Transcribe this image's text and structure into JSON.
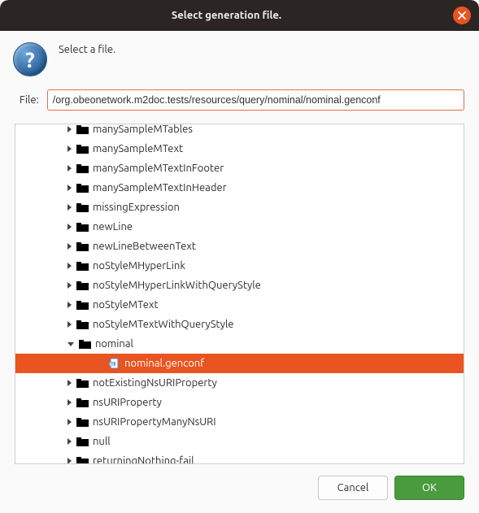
{
  "window": {
    "title": "Select generation file."
  },
  "header": {
    "message": "Select a file."
  },
  "file": {
    "label": "File:",
    "value": "/org.obeonetwork.m2doc.tests/resources/query/nominal/nominal.genconf"
  },
  "tree": {
    "items": [
      {
        "label": "manySampleMTables",
        "type": "folder",
        "expandable": true,
        "expanded": false,
        "depth": 0,
        "cut": "top"
      },
      {
        "label": "manySampleMText",
        "type": "folder",
        "expandable": true,
        "expanded": false,
        "depth": 0
      },
      {
        "label": "manySampleMTextInFooter",
        "type": "folder",
        "expandable": true,
        "expanded": false,
        "depth": 0
      },
      {
        "label": "manySampleMTextInHeader",
        "type": "folder",
        "expandable": true,
        "expanded": false,
        "depth": 0
      },
      {
        "label": "missingExpression",
        "type": "folder",
        "expandable": true,
        "expanded": false,
        "depth": 0
      },
      {
        "label": "newLine",
        "type": "folder",
        "expandable": true,
        "expanded": false,
        "depth": 0
      },
      {
        "label": "newLineBetweenText",
        "type": "folder",
        "expandable": true,
        "expanded": false,
        "depth": 0
      },
      {
        "label": "noStyleMHyperLink",
        "type": "folder",
        "expandable": true,
        "expanded": false,
        "depth": 0
      },
      {
        "label": "noStyleMHyperLinkWithQueryStyle",
        "type": "folder",
        "expandable": true,
        "expanded": false,
        "depth": 0
      },
      {
        "label": "noStyleMText",
        "type": "folder",
        "expandable": true,
        "expanded": false,
        "depth": 0
      },
      {
        "label": "noStyleMTextWithQueryStyle",
        "type": "folder",
        "expandable": true,
        "expanded": false,
        "depth": 0
      },
      {
        "label": "nominal",
        "type": "folder",
        "expandable": true,
        "expanded": true,
        "depth": 0
      },
      {
        "label": "nominal.genconf",
        "type": "file",
        "expandable": false,
        "expanded": false,
        "depth": 1,
        "selected": true
      },
      {
        "label": "notExistingNsURIProperty",
        "type": "folder",
        "expandable": true,
        "expanded": false,
        "depth": 0
      },
      {
        "label": "nsURIProperty",
        "type": "folder",
        "expandable": true,
        "expanded": false,
        "depth": 0
      },
      {
        "label": "nsURIPropertyManyNsURI",
        "type": "folder",
        "expandable": true,
        "expanded": false,
        "depth": 0
      },
      {
        "label": "null",
        "type": "folder",
        "expandable": true,
        "expanded": false,
        "depth": 0
      },
      {
        "label": "returningNothing-fail",
        "type": "folder",
        "expandable": true,
        "expanded": false,
        "depth": 0,
        "cut": "bottom"
      }
    ]
  },
  "buttons": {
    "cancel": "Cancel",
    "ok": "OK"
  }
}
